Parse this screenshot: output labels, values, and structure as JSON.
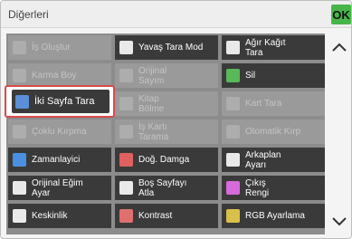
{
  "dialog": {
    "title": "Diğerleri",
    "ok_label": "OK"
  },
  "scroll": {
    "up_icon": "chevron-up-icon",
    "down_icon": "chevron-down-icon"
  },
  "grid": {
    "rows": [
      [
        {
          "label": "İş Oluştur",
          "enabled": false,
          "icon": "job-build-icon"
        },
        {
          "label": "Yavaş Tara Mod",
          "enabled": true,
          "icon": "slow-scan-icon"
        },
        {
          "label": "Ağır Kağıt\nTara",
          "enabled": true,
          "icon": "heavy-paper-icon"
        }
      ],
      [
        {
          "label": "Karma Boy",
          "enabled": false,
          "icon": "mixed-size-icon"
        },
        {
          "label": "Orijinal\nSayım",
          "enabled": false,
          "icon": "original-count-icon"
        },
        {
          "label": "Sil",
          "enabled": true,
          "icon": "erase-icon"
        }
      ],
      [
        {
          "label": "İki Sayfa Tara",
          "enabled": true,
          "icon": "two-page-scan-icon",
          "selected": true
        },
        {
          "label": "Kitap\nBölme",
          "enabled": false,
          "icon": "book-divide-icon"
        },
        {
          "label": "Kart Tara",
          "enabled": false,
          "icon": "card-scan-icon"
        }
      ],
      [
        {
          "label": "Çoklu Kırpma",
          "enabled": false,
          "icon": "multi-crop-icon"
        },
        {
          "label": "İş Kartı\nTarama",
          "enabled": false,
          "icon": "business-card-icon"
        },
        {
          "label": "Otomatik Kırp",
          "enabled": false,
          "icon": "auto-crop-icon"
        }
      ],
      [
        {
          "label": "Zamanlayici",
          "enabled": true,
          "icon": "timer-icon"
        },
        {
          "label": "Doğ. Damga",
          "enabled": true,
          "icon": "stamp-icon"
        },
        {
          "label": "Arkaplan\nAyarı",
          "enabled": true,
          "icon": "background-icon"
        }
      ],
      [
        {
          "label": "Orijinal Eğim\nAyar",
          "enabled": true,
          "icon": "skew-adjust-icon"
        },
        {
          "label": "Boş Sayfayı\nAtla",
          "enabled": true,
          "icon": "blank-page-icon"
        },
        {
          "label": "Çıkış\nRengi",
          "enabled": true,
          "icon": "output-color-icon"
        }
      ],
      [
        {
          "label": "Keskinlik",
          "enabled": true,
          "icon": "sharpness-icon"
        },
        {
          "label": "Kontrast",
          "enabled": true,
          "icon": "contrast-icon"
        },
        {
          "label": "RGB Ayarlama",
          "enabled": true,
          "icon": "rgb-adjust-icon"
        }
      ]
    ]
  },
  "selected_item": {
    "label": "İki Sayfa Tara"
  }
}
